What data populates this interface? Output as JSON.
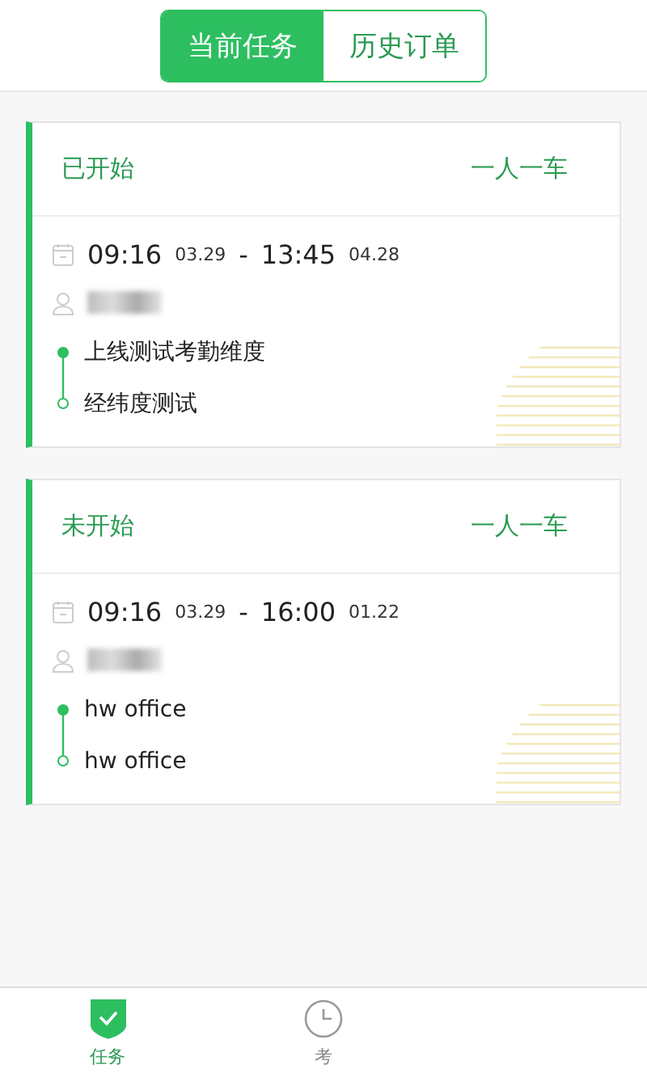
{
  "segments": [
    {
      "label": "当前任务",
      "selected": true
    },
    {
      "label": "历史订单",
      "selected": false
    }
  ],
  "tasks": [
    {
      "status": "已开始",
      "type": "一人一车",
      "start_time": "09:16",
      "start_date": "03.29",
      "separator": "-",
      "end_time": "13:45",
      "end_date": "04.28",
      "route": [
        {
          "name": "上线测试考勤维度",
          "kind": "start"
        },
        {
          "name": "经纬度测试",
          "kind": "end"
        }
      ]
    },
    {
      "status": "未开始",
      "type": "一人一车",
      "start_time": "09:16",
      "start_date": "03.29",
      "separator": "-",
      "end_time": "16:00",
      "end_date": "01.22",
      "route": [
        {
          "name": "hw office",
          "kind": "start"
        },
        {
          "name": "hw office",
          "kind": "end"
        }
      ]
    }
  ],
  "bottom_tabs": [
    {
      "label": "任务",
      "selected": true
    },
    {
      "label": "考",
      "selected": false
    }
  ]
}
